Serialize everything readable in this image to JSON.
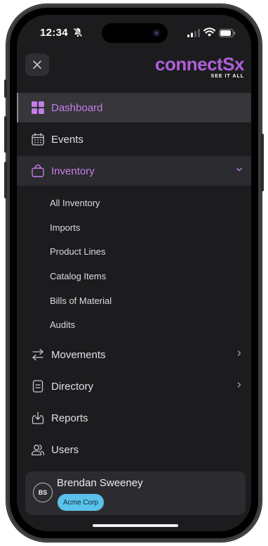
{
  "status_bar": {
    "time": "12:34"
  },
  "header": {
    "close_icon": "close-icon",
    "logo": {
      "word_part1": "connect",
      "word_part2": "Sx",
      "tagline": "SEE IT ALL"
    }
  },
  "nav": {
    "dashboard": "Dashboard",
    "events": "Events",
    "inventory": "Inventory",
    "inventory_sub": [
      "All Inventory",
      "Imports",
      "Product Lines",
      "Catalog Items",
      "Bills of Material",
      "Audits"
    ],
    "movements": "Movements",
    "directory": "Directory",
    "reports": "Reports",
    "users": "Users"
  },
  "user": {
    "initials": "BS",
    "name": "Brendan Sweeney",
    "org": "Acme Corp"
  },
  "colors": {
    "accent": "#b05fd8",
    "badge": "#5ac1ea",
    "background": "#1c1c1e"
  }
}
